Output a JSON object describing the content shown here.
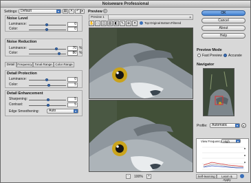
{
  "window": {
    "title": "Noiseware Professional"
  },
  "settings": {
    "label": "Settings:",
    "value": "Default"
  },
  "noise_level": {
    "title": "Noise Level",
    "luminance_label": "Luminance:",
    "luminance_value": "0",
    "color_label": "Color:",
    "color_value": "0"
  },
  "noise_reduction": {
    "title": "Noise Reduction",
    "luminance_label": "Luminance:",
    "luminance_value": "70",
    "luminance_unit": "%",
    "color_label": "Color:",
    "color_value": "80",
    "color_unit": "%"
  },
  "tabs": [
    "Detail",
    "Frequency",
    "Tonal Range",
    "Color Range"
  ],
  "detail_protection": {
    "title": "Detail Protection",
    "luminance_label": "Luminance:",
    "luminance_value": "0",
    "color_label": "Color:",
    "color_value": "5"
  },
  "detail_enhancement": {
    "title": "Detail Enhancement",
    "sharpening_label": "Sharpening:",
    "sharpening_value": "5",
    "contrast_label": "Contrast:",
    "contrast_value": "5",
    "edge_label": "Edge Smoothening:",
    "edge_value": "Auto"
  },
  "preview": {
    "title": "Preview",
    "tab": "Preview 1",
    "mode_text": "Top:Original Bottom:Filtered",
    "zoom": "100%"
  },
  "buttons": {
    "ok": "OK",
    "cancel": "Cancel",
    "about": "About",
    "help": "Help"
  },
  "preview_mode": {
    "title": "Preview Mode",
    "fast": "Fast Preview",
    "accurate": "Accurate"
  },
  "navigator": {
    "title": "Navigator"
  },
  "profile": {
    "label": "Profile:",
    "value": "Automatic",
    "view_label": "View Frequency:",
    "view_value": "High"
  },
  "bottom_tabs": [
    "Self-learning",
    "Learn & Apply"
  ],
  "colors": {
    "accent": "#3a6fb8",
    "panel": "#d8d8d8"
  }
}
